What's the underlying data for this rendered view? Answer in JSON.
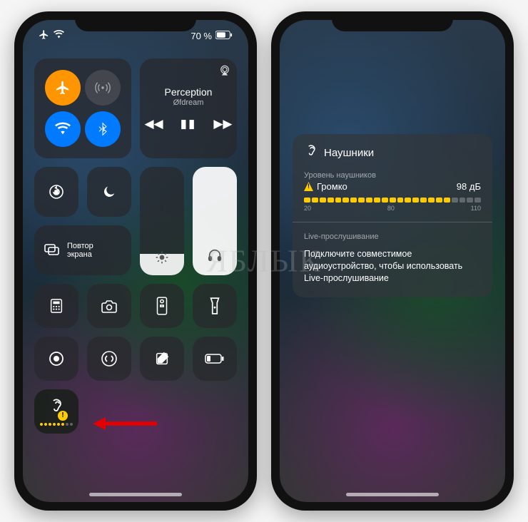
{
  "statusbar": {
    "battery_text": "70 %"
  },
  "connectivity": {
    "airplane_active": true,
    "cellular_active": false,
    "wifi_active": true,
    "bluetooth_active": true
  },
  "media": {
    "title": "Perception",
    "artist": "Øfdream"
  },
  "screen_mirror_label": "Повтор\nэкрана",
  "hearing_panel": {
    "headphones_label": "Наушники",
    "level_label": "Уровень наушников",
    "loud_label": "Громко",
    "db_value": "98 дБ",
    "scale": {
      "s1": "20",
      "s2": "80",
      "s3": "110"
    },
    "live_label": "Live-прослушивание",
    "live_text": "Подключите совместимое аудиоустройство, чтобы использовать Live-прослушивание"
  },
  "watermark": "ЯБЛЫК"
}
